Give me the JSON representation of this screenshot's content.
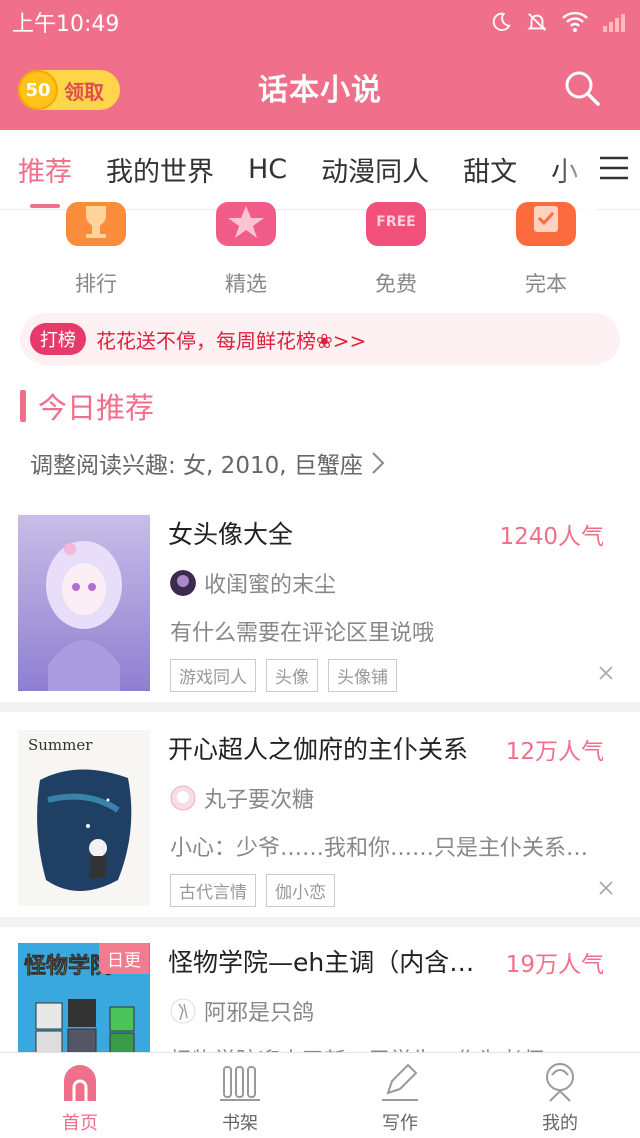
{
  "status_bar": {
    "time": "上午10:49"
  },
  "header": {
    "title": "话本小说",
    "coin_count": "50",
    "claim_label": "领取"
  },
  "tabs": [
    "推荐",
    "我的世界",
    "HC",
    "动漫同人",
    "甜文",
    "小"
  ],
  "quick_entries": [
    {
      "label": "排行",
      "color": "#fa8c3c"
    },
    {
      "label": "精选",
      "color": "#f25c89"
    },
    {
      "label": "免费",
      "color": "#f0507a",
      "badge": "FREE"
    },
    {
      "label": "完本",
      "color": "#fb6b3e"
    }
  ],
  "banner": {
    "badge": "打榜",
    "text": "花花送不停，每周鲜花榜❀>>"
  },
  "section": {
    "title": "今日推荐",
    "preference": "调整阅读兴趣: 女, 2010, 巨蟹座"
  },
  "books": [
    {
      "title": "女头像大全",
      "popularity": "1240人气",
      "author": "收闺蜜的末尘",
      "description": "有什么需要在评论区里说哦",
      "tags": [
        "游戏同人",
        "头像",
        "头像铺"
      ]
    },
    {
      "title": "开心超人之伽府的主仆关系",
      "popularity": "12万人气",
      "author": "丸子要次糖",
      "description": "小心：少爷……我和你……只是主仆关系…",
      "tags": [
        "古代言情",
        "伽小恋"
      ],
      "cover_text": "Summer"
    },
    {
      "title": "怪物学院—eh主调（内含…",
      "popularity": "19万人气",
      "author": "阿邪是只鸽",
      "description": "怪物学院迎来了新一届学生，作为老师",
      "tags": [],
      "badge": "日更",
      "cover_text": "怪物学院"
    }
  ],
  "bottom_nav": [
    {
      "label": "首页",
      "active": true
    },
    {
      "label": "书架",
      "active": false
    },
    {
      "label": "写作",
      "active": false
    },
    {
      "label": "我的",
      "active": false
    }
  ],
  "colors": {
    "brand": "#f06f8a",
    "accent_red": "#e0203c"
  }
}
